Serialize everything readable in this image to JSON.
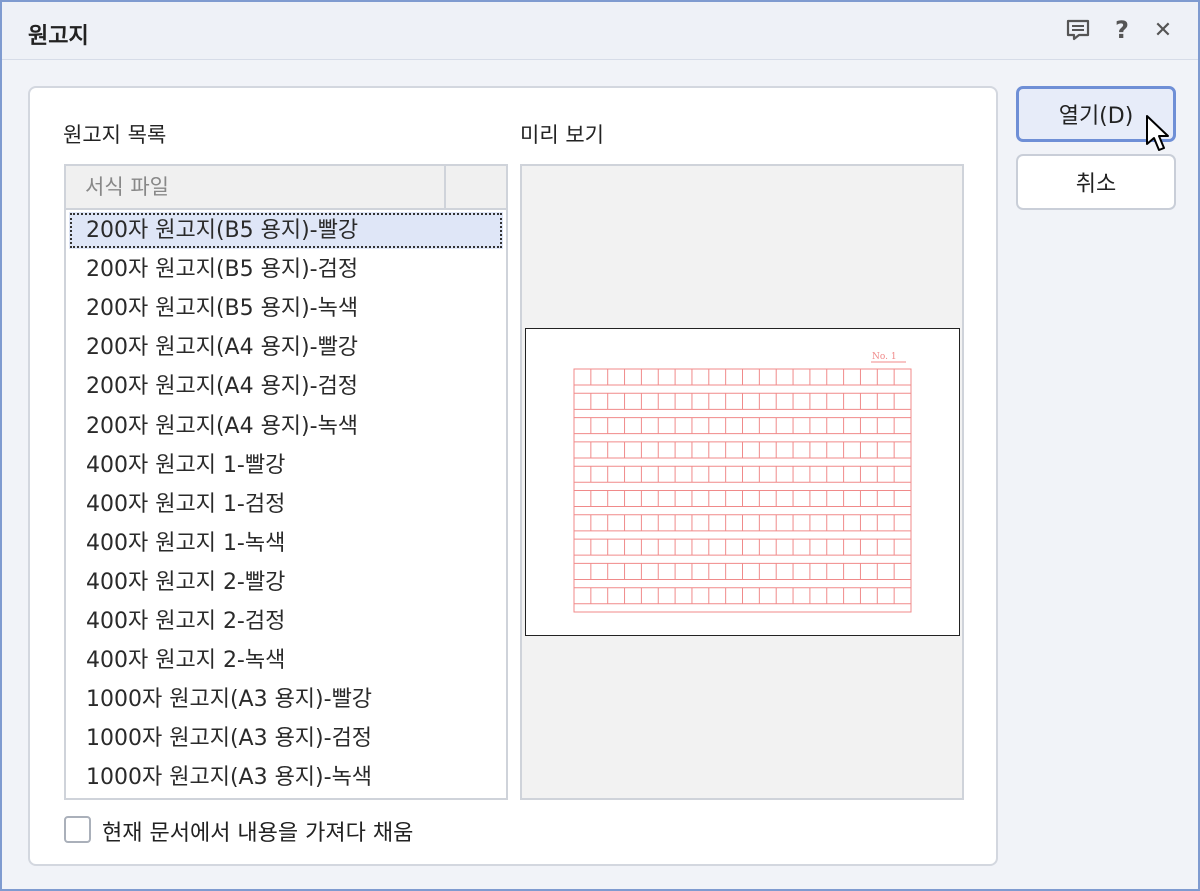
{
  "window": {
    "title": "원고지",
    "icons": [
      "comment-icon",
      "help-icon",
      "close-icon"
    ],
    "help_glyph": "?",
    "close_glyph": "✕"
  },
  "list": {
    "label": "원고지 목록",
    "column_header": "서식 파일",
    "items": [
      "200자 원고지(B5 용지)-빨강",
      "200자 원고지(B5 용지)-검정",
      "200자 원고지(B5 용지)-녹색",
      "200자 원고지(A4 용지)-빨강",
      "200자 원고지(A4 용지)-검정",
      "200자 원고지(A4 용지)-녹색",
      "400자 원고지 1-빨강",
      "400자 원고지 1-검정",
      "400자 원고지 1-녹색",
      "400자 원고지 2-빨강",
      "400자 원고지 2-검정",
      "400자 원고지 2-녹색",
      "1000자 원고지(A3 용지)-빨강",
      "1000자 원고지(A3 용지)-검정",
      "1000자 원고지(A3 용지)-녹색"
    ],
    "selected_index": 0
  },
  "preview": {
    "label": "미리 보기",
    "page_number_text": "No.   1",
    "grid_color": "#f08a8a"
  },
  "options": {
    "fill_from_document_label": "현재 문서에서 내용을 가져다 채움",
    "fill_from_document_checked": false
  },
  "buttons": {
    "open_label": "열기(D)",
    "cancel_label": "취소"
  },
  "colors": {
    "accent": "#6f8fd6",
    "selection": "#dfe6f7"
  }
}
